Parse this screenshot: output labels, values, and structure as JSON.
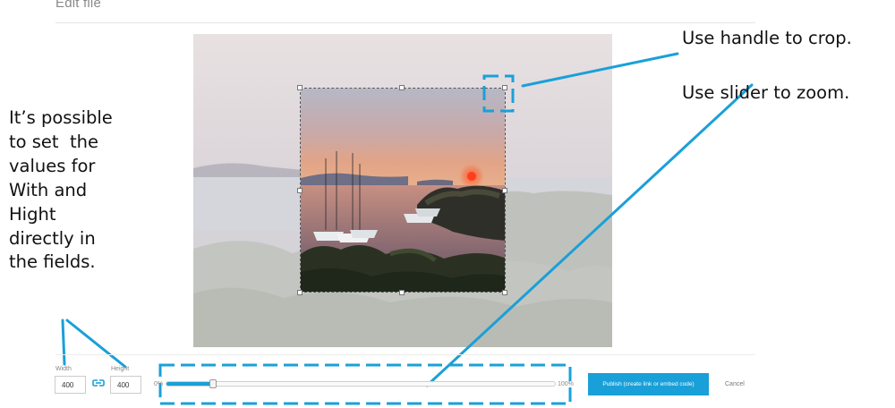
{
  "header": {
    "title": "Edit file"
  },
  "annotations": {
    "fields_note": [
      "It’s possible",
      "to set  the",
      "values for",
      "With and",
      "Hight",
      "directly in",
      "the fields."
    ],
    "crop_note": "Use handle to crop.",
    "zoom_note": "Use slider to zoom."
  },
  "controls": {
    "width_label": "Width",
    "width_value": "400",
    "height_label": "Height",
    "height_value": "400",
    "link_icon": "link-chain-icon",
    "zoom_min_label": "0%",
    "zoom_max_label": "100%",
    "zoom_level": 0.12,
    "publish_label": "Publish (create link or embed code)",
    "cancel_label": "Cancel"
  },
  "colors": {
    "accent": "#1aa0d8",
    "annotation": "#1aa0d8"
  }
}
